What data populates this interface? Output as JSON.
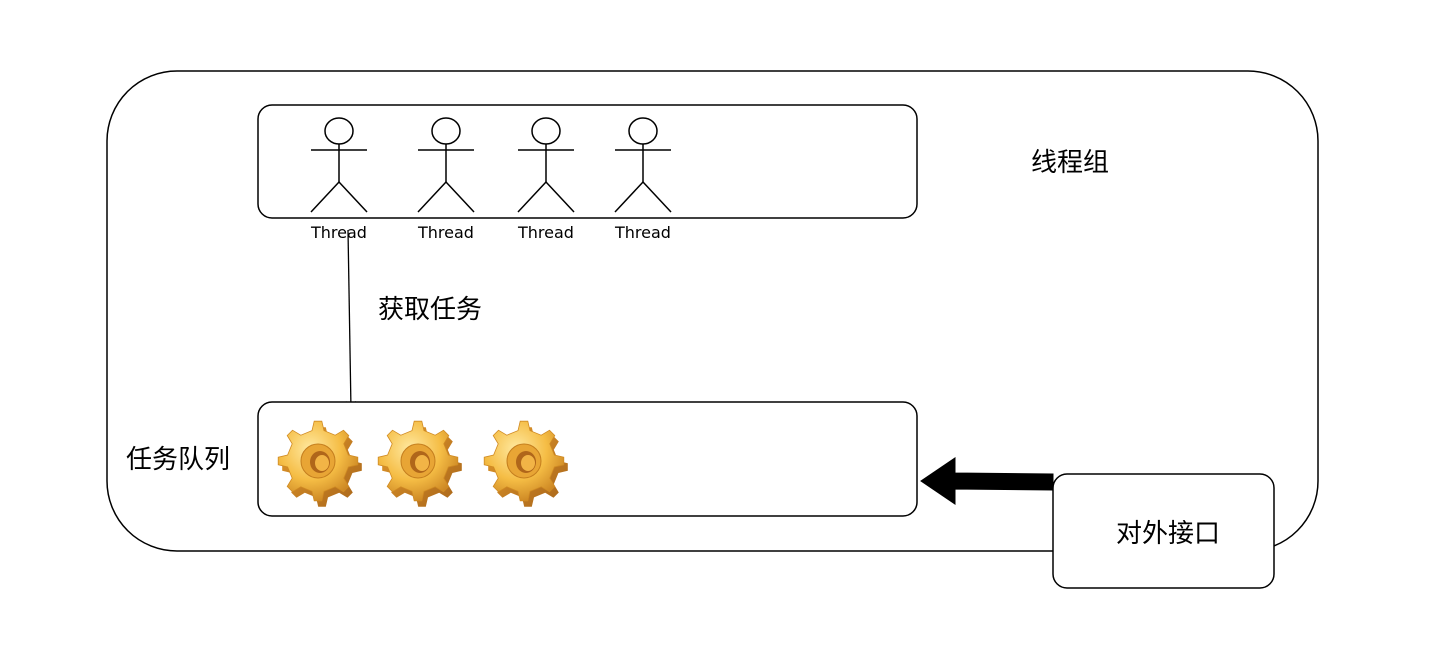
{
  "thread_pool": {
    "label": "线程组",
    "threads": [
      {
        "label": "Thread"
      },
      {
        "label": "Thread"
      },
      {
        "label": "Thread"
      },
      {
        "label": "Thread"
      }
    ]
  },
  "fetch_task": {
    "label": "获取任务"
  },
  "task_queue": {
    "label": "任务队列",
    "task_count": 3,
    "task_icon": "gear-icon"
  },
  "external_interface": {
    "label": "对外接口"
  },
  "colors": {
    "stroke": "#000000",
    "background": "#ffffff",
    "gear_light": "#ffe082",
    "gear_mid": "#f5b93a",
    "gear_dark": "#c8801f"
  }
}
